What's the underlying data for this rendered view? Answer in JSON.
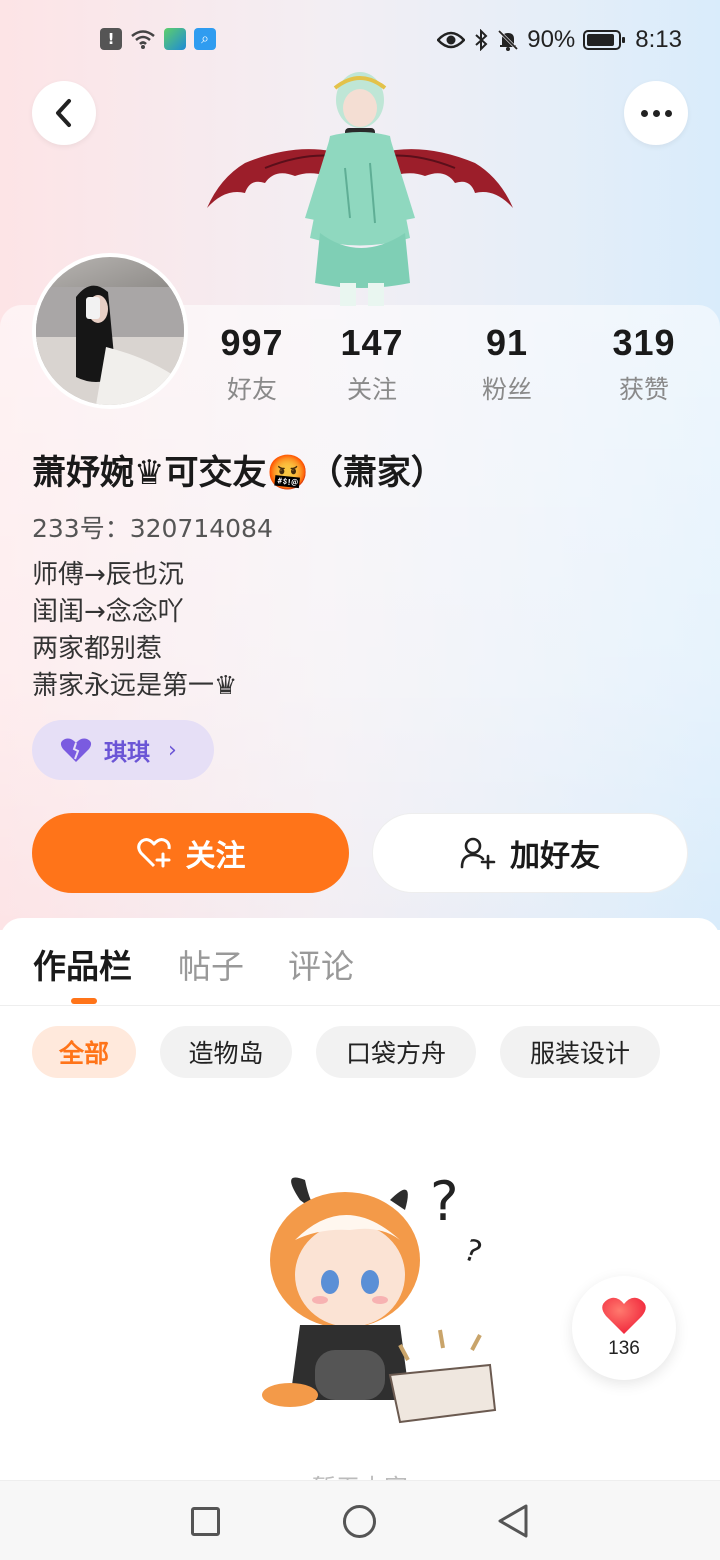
{
  "status_bar": {
    "battery": "90%",
    "time": "8:13"
  },
  "header": {
    "back_icon": "chevron-left-icon",
    "more_icon": "more-dots-icon"
  },
  "profile": {
    "stats": [
      {
        "value": "997",
        "label": "好友"
      },
      {
        "value": "147",
        "label": "关注"
      },
      {
        "value": "91",
        "label": "粉丝"
      },
      {
        "value": "319",
        "label": "获赞"
      }
    ],
    "nickname": "萧妤婉♛可交友🤬（萧家）",
    "uid": "233号：320714084",
    "bio": [
      "师傅→辰也沉",
      "闺闺→念念吖",
      "两家都别惹",
      "萧家永远是第一♛"
    ],
    "relation_tag": {
      "icon": "heart-icon",
      "label": "琪琪",
      "color": "#6b55d6"
    }
  },
  "actions": {
    "follow_label": "关注",
    "add_friend_label": "加好友",
    "accent_color": "#ff7419"
  },
  "tabs": [
    {
      "label": "作品栏",
      "active": true
    },
    {
      "label": "帖子",
      "active": false
    },
    {
      "label": "评论",
      "active": false
    }
  ],
  "filters": [
    {
      "label": "全部",
      "active": true
    },
    {
      "label": "造物岛",
      "active": false
    },
    {
      "label": "口袋方舟",
      "active": false
    },
    {
      "label": "服装设计",
      "active": false
    }
  ],
  "empty_state": {
    "text": "暂无内容"
  },
  "like_button": {
    "icon": "heart-icon",
    "count": "136"
  },
  "nav_bar": {
    "icons": [
      "recent-apps-icon",
      "home-icon",
      "back-icon"
    ]
  }
}
